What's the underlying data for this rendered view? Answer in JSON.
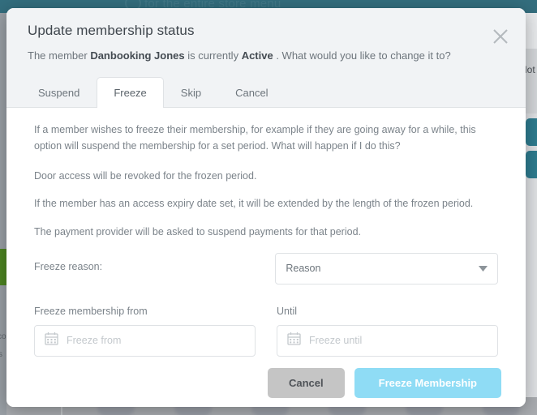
{
  "background": {
    "topbar_text": "for the entire store menu",
    "notes_label": "Not",
    "left_text_1": "co",
    "left_text_2": "s",
    "colors": {
      "topbar": "#336e7e",
      "panel": "#dfe1e4",
      "green_marker": "#4d8521",
      "teal_button": "#2e7c8f"
    }
  },
  "modal": {
    "title": "Update membership status",
    "close_icon": "close-icon",
    "subtitle": {
      "prefix": "The member ",
      "member_name": "Danbooking Jones",
      "middle": " is currently ",
      "status": "Active",
      "suffix": " . What would you like to change it to?"
    },
    "tabs": [
      {
        "label": "Suspend",
        "active": false
      },
      {
        "label": "Freeze",
        "active": true
      },
      {
        "label": "Skip",
        "active": false
      },
      {
        "label": "Cancel",
        "active": false
      }
    ],
    "paragraphs": [
      "If a member wishes to freeze their membership, for example if they are going away for a while, this option will suspend the membership for a set period. What will happen if I do this?",
      "Door access will be revoked for the frozen period.",
      "If the member has an access expiry date set, it will be extended by the length of the frozen period.",
      "The payment provider will be asked to suspend payments for that period."
    ],
    "reason": {
      "label": "Freeze reason:",
      "selected": "Reason",
      "dropdown_icon": "chevron-down-icon"
    },
    "date_from": {
      "label": "Freeze membership from",
      "placeholder": "Freeze from",
      "value": "",
      "icon": "calendar-icon"
    },
    "date_until": {
      "label": "Until",
      "placeholder": "Freeze until",
      "value": "",
      "icon": "calendar-icon"
    },
    "footer": {
      "cancel_label": "Cancel",
      "submit_label": "Freeze Membership",
      "submit_color": "#8fdcf5",
      "cancel_color": "#c5c5c5"
    }
  }
}
